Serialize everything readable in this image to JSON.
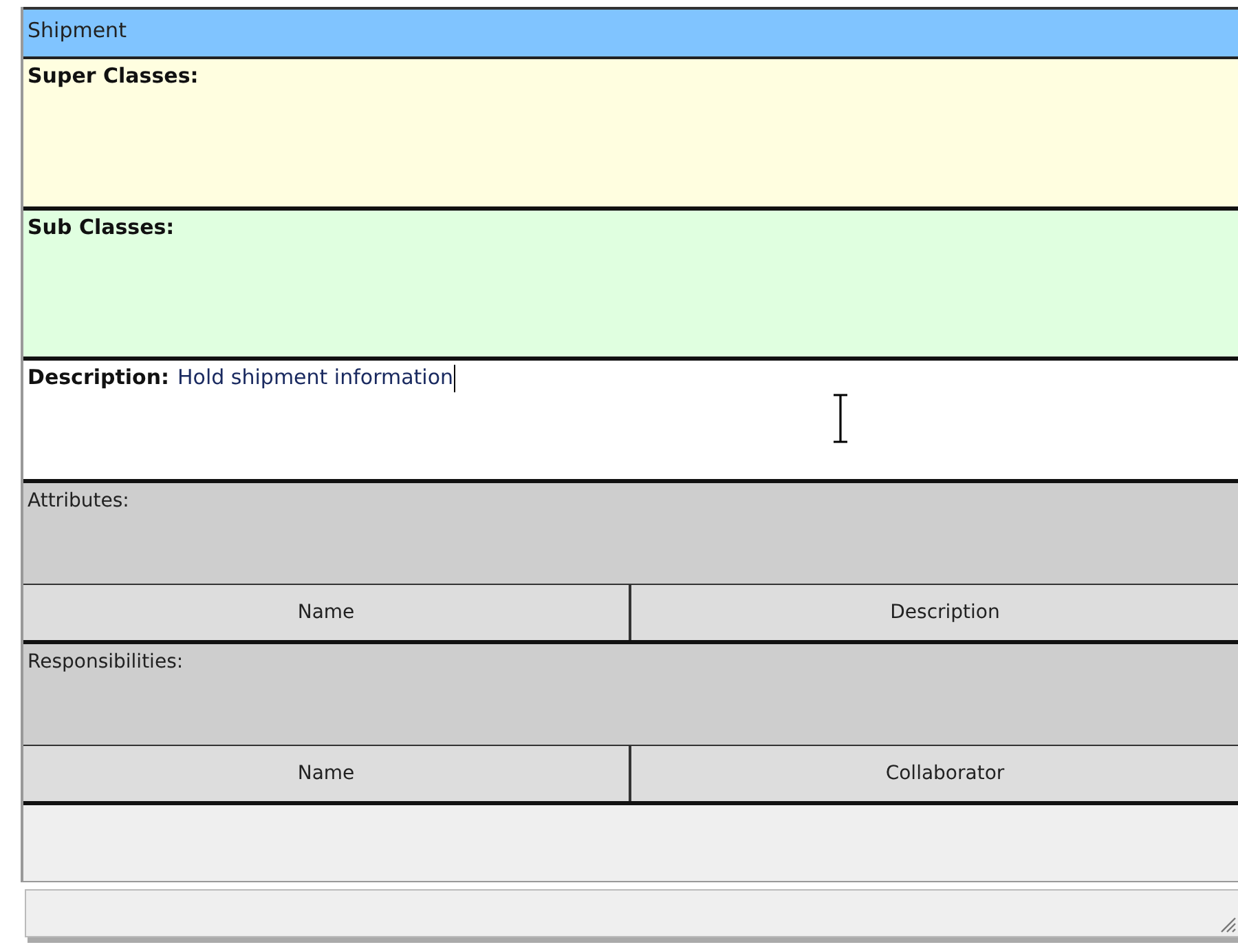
{
  "title": "Shipment",
  "super_classes": {
    "label": "Super Classes:"
  },
  "sub_classes": {
    "label": "Sub Classes:"
  },
  "description": {
    "label": "Description:",
    "value": "Hold shipment information"
  },
  "attributes": {
    "label": "Attributes:",
    "columns": [
      "Name",
      "Description"
    ]
  },
  "responsibilities": {
    "label": "Responsibilities:",
    "columns": [
      "Name",
      "Collaborator"
    ]
  }
}
